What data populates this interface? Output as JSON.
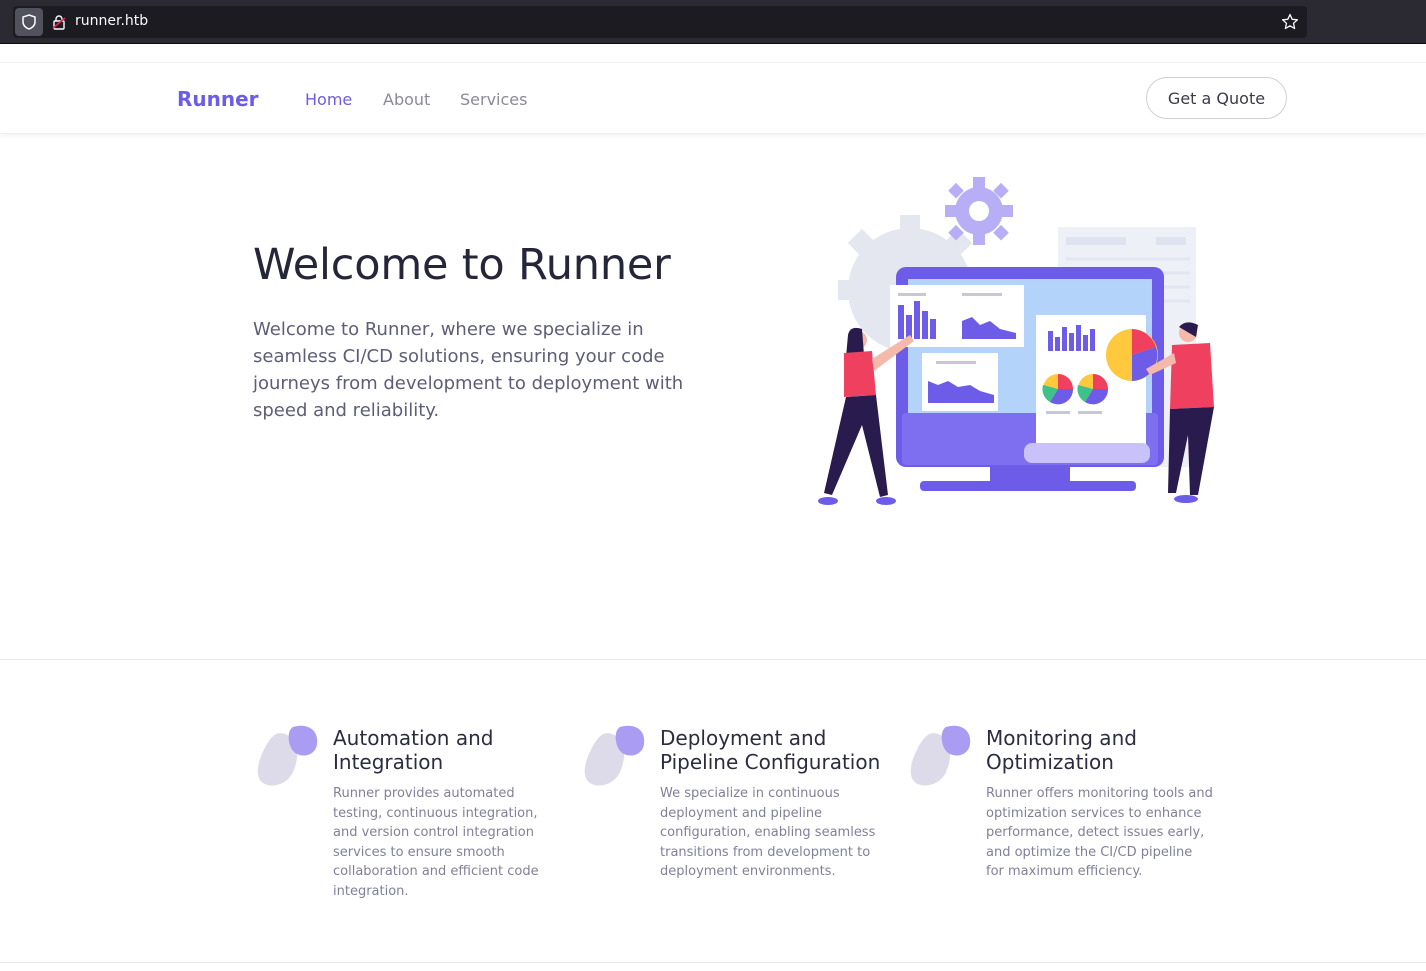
{
  "browser": {
    "url": "runner.htb"
  },
  "nav": {
    "brand": "Runner",
    "links": [
      {
        "label": "Home",
        "active": true
      },
      {
        "label": "About",
        "active": false
      },
      {
        "label": "Services",
        "active": false
      }
    ],
    "cta": "Get a Quote"
  },
  "hero": {
    "title": "Welcome to Runner",
    "text": "Welcome to Runner, where we specialize in seamless CI/CD solutions, ensuring your code journeys from development to deployment with speed and reliability."
  },
  "features": [
    {
      "title": "Automation and Integration",
      "text": "Runner provides automated testing, continuous integration, and version control integration services to ensure smooth collaboration and efficient code integration."
    },
    {
      "title": "Deployment and Pipeline Configuration",
      "text": "We specialize in continuous deployment and pipeline configuration, enabling seamless transitions from development to deployment environments."
    },
    {
      "title": "Monitoring and Optimization",
      "text": "Runner offers monitoring tools and optimization services to enhance performance, detect issues early, and optimize the CI/CD pipeline for maximum efficiency."
    }
  ],
  "colors": {
    "accent": "#6c5ce7",
    "blob_light": "#dddbe9",
    "blob_accent": "#a99cf2"
  }
}
